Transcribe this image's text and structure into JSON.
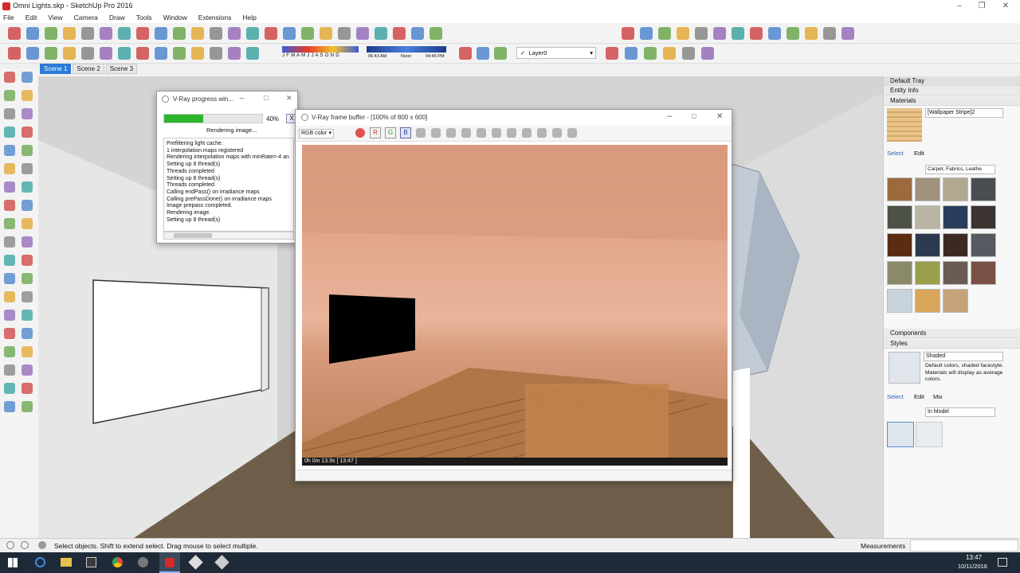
{
  "window": {
    "title": "Omni Lights.skp - SketchUp Pro 2016"
  },
  "menu": [
    "File",
    "Edit",
    "View",
    "Camera",
    "Draw",
    "Tools",
    "Window",
    "Extensions",
    "Help"
  ],
  "shadow_bar": {
    "months": "J F M A M J J A S O N D",
    "time_start": "06:43 AM",
    "time_mid": "Noon",
    "time_end": "04:45 PM"
  },
  "layer": {
    "check": "✓",
    "name": "Layer0"
  },
  "scenes": [
    "Scene 1",
    "Scene 2",
    "Scene 3"
  ],
  "progress_dialog": {
    "title": "V-Ray progress win...",
    "percent": "40%",
    "progress_value": 0.4,
    "close_label": "X",
    "status": "Rendering image...",
    "log": [
      "Prefiltering light cache.",
      "1 interpolation maps registered",
      "Rendering interpolation maps with minRate=-4 an",
      "Setting up 8 thread(s)",
      "Threads completed",
      "Setting up 8 thread(s)",
      "Threads completed",
      "Calling endPass() on irradiance maps",
      "Calling prePassDone() on irradiance maps",
      "Image prepass completed.",
      "Rendering image.",
      "Setting up 8 thread(s)"
    ]
  },
  "vfb": {
    "title": "V-Ray frame buffer - [100% of 800 x 600]",
    "channel": "RGB color",
    "r": "R",
    "g": "G",
    "b": "B",
    "time_readout": "0h  0m 13.9s  [ 13:47 ]"
  },
  "tray": {
    "title": "Default Tray",
    "entity_info": "Entity Info",
    "materials": "Materials",
    "material_name": "[Wallpaper Stripe]2",
    "select_tab": "Select",
    "edit_tab": "Edit",
    "library": "Carpet, Fabrics, Leathe",
    "components": "Components",
    "styles": "Styles",
    "style_name": "Shaded",
    "style_desc": "Default colors, shaded facestyle. Materials will display as average colors.",
    "styles_select": "Select",
    "styles_edit": "Edit",
    "styles_mix": "Mix",
    "styles_library": "In Model",
    "swatch_colors": [
      "#9c6a3c",
      "#a0927c",
      "#b0a890",
      "#4a4e52",
      "#4d5248",
      "#b9b4a3",
      "#2a3d5c",
      "#3b3430",
      "#5a2c12",
      "#2b3a4e",
      "#3c2a22",
      "#555a60",
      "#8a8a6a",
      "#9aa04a",
      "#6a5c55",
      "#7a5044",
      "#c9d3dc",
      "#d9a55a",
      "#c6a27a"
    ]
  },
  "status": {
    "hint": "Select objects. Shift to extend select. Drag mouse to select multiple.",
    "measurements": "Measurements"
  },
  "taskbar": {
    "time": "13:47",
    "date": "10/11/2016"
  }
}
